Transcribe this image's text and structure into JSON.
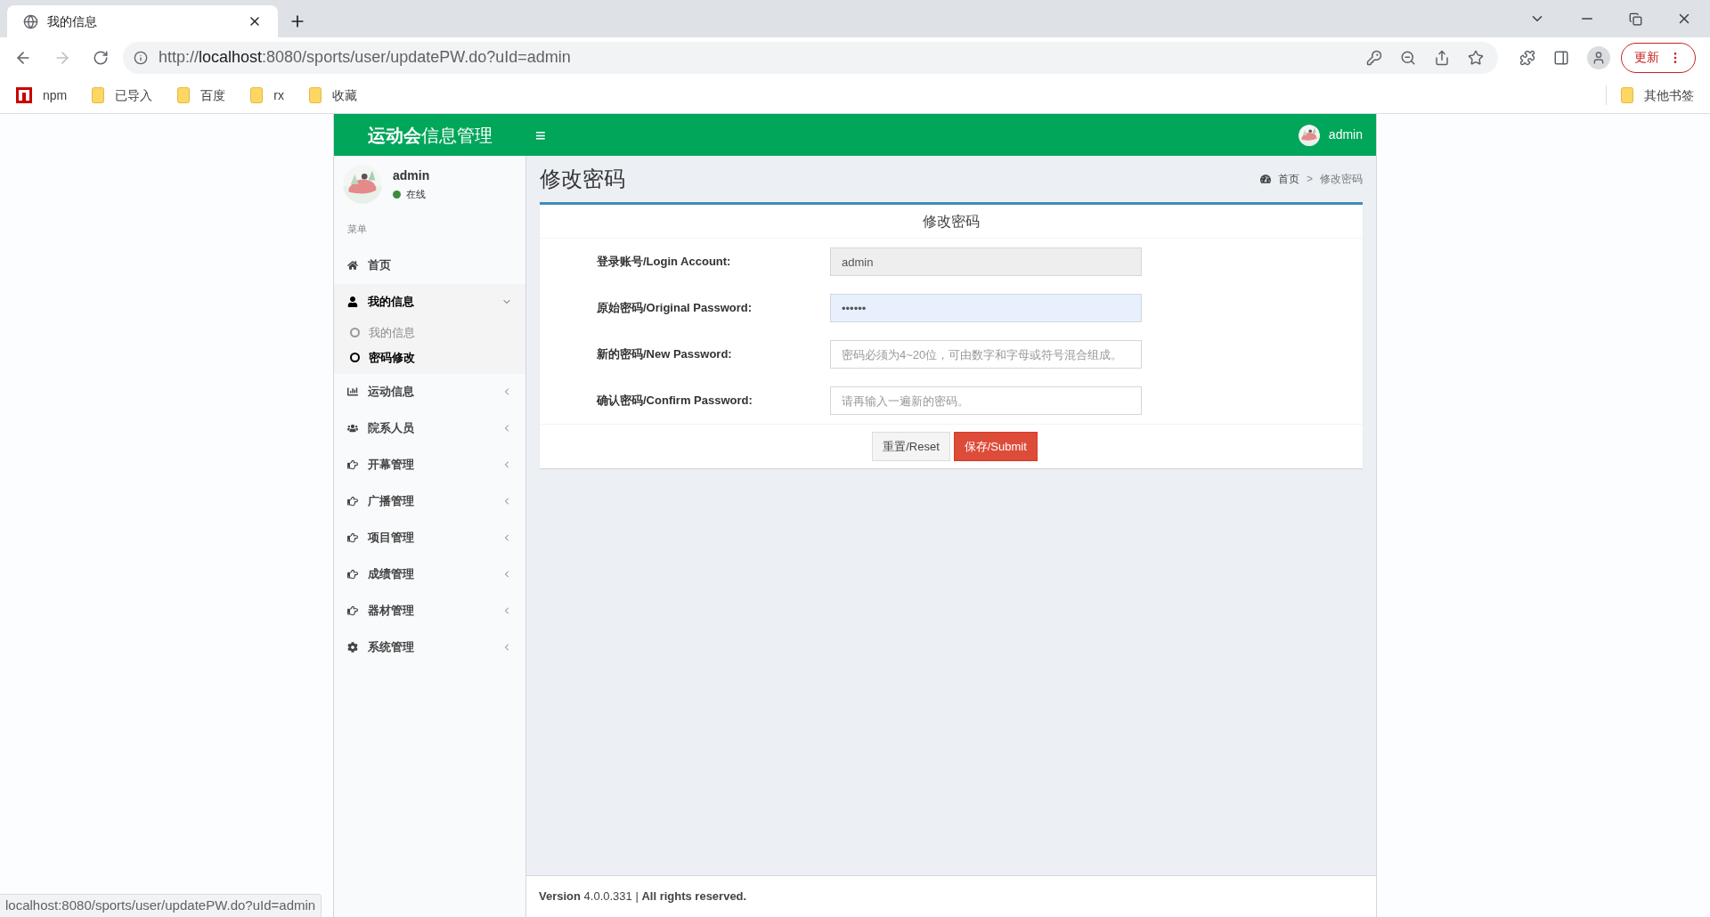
{
  "browser": {
    "tab_title": "我的信息",
    "url_prefix": "http://",
    "url_host": "localhost",
    "url_rest": ":8080/sports/user/updatePW.do?uId=admin",
    "update_button": "更新",
    "bookmarks": [
      {
        "label": "npm",
        "kind": "npm"
      },
      {
        "label": "已导入",
        "kind": "folder"
      },
      {
        "label": "百度",
        "kind": "folder"
      },
      {
        "label": "rx",
        "kind": "folder"
      },
      {
        "label": "收藏",
        "kind": "folder"
      }
    ],
    "other_bookmarks": "其他书签"
  },
  "header": {
    "brand_bold": "运动会",
    "brand_rest": "信息管理",
    "menu_glyph": "≡",
    "user": "admin"
  },
  "sidebar": {
    "user": "admin",
    "status": {
      "label": "在线",
      "color": "#3c8c3c"
    },
    "menu_title": "菜单",
    "items": [
      {
        "label": "首页",
        "kind": "link"
      },
      {
        "label": "我的信息",
        "kind": "group",
        "expanded": true,
        "children": [
          {
            "label": "我的信息",
            "selected": false
          },
          {
            "label": "密码修改",
            "selected": true
          }
        ]
      },
      {
        "label": "运动信息",
        "kind": "group",
        "expanded": false
      },
      {
        "label": "院系人员",
        "kind": "group",
        "expanded": false
      },
      {
        "label": "开幕管理",
        "kind": "group",
        "expanded": false
      },
      {
        "label": "广播管理",
        "kind": "group",
        "expanded": false
      },
      {
        "label": "项目管理",
        "kind": "group",
        "expanded": false
      },
      {
        "label": "成绩管理",
        "kind": "group",
        "expanded": false
      },
      {
        "label": "器材管理",
        "kind": "group",
        "expanded": false
      },
      {
        "label": "系统管理",
        "kind": "group",
        "expanded": false
      }
    ]
  },
  "page": {
    "title": "修改密码",
    "breadcrumb": [
      "首页",
      ">",
      "修改密码"
    ],
    "form": {
      "title": "修改密码",
      "fields": [
        {
          "label": "登录账号/Login Account:",
          "value": "admin",
          "disabled": true,
          "autofilled": false
        },
        {
          "label": "原始密码/Original Password:",
          "value": "••••••",
          "disabled": false,
          "autofilled": true
        },
        {
          "label": "新的密码/New Password:",
          "placeholder": "密码必须为4~20位，可由数字和字母或符号混合组成。",
          "disabled": false,
          "autofilled": false
        },
        {
          "label": "确认密码/Confirm Password:",
          "placeholder": "请再输入一遍新的密码。",
          "disabled": false,
          "autofilled": false
        }
      ],
      "buttons": [
        {
          "label": "重置/Reset",
          "kind": "default"
        },
        {
          "label": "保存/Submit",
          "kind": "danger"
        }
      ]
    }
  },
  "footer": "**Version** 4.0.0.331 | **All rights reserved.**",
  "status_url": "localhost:8080/sports/user/updatePW.do?uId=admin"
}
